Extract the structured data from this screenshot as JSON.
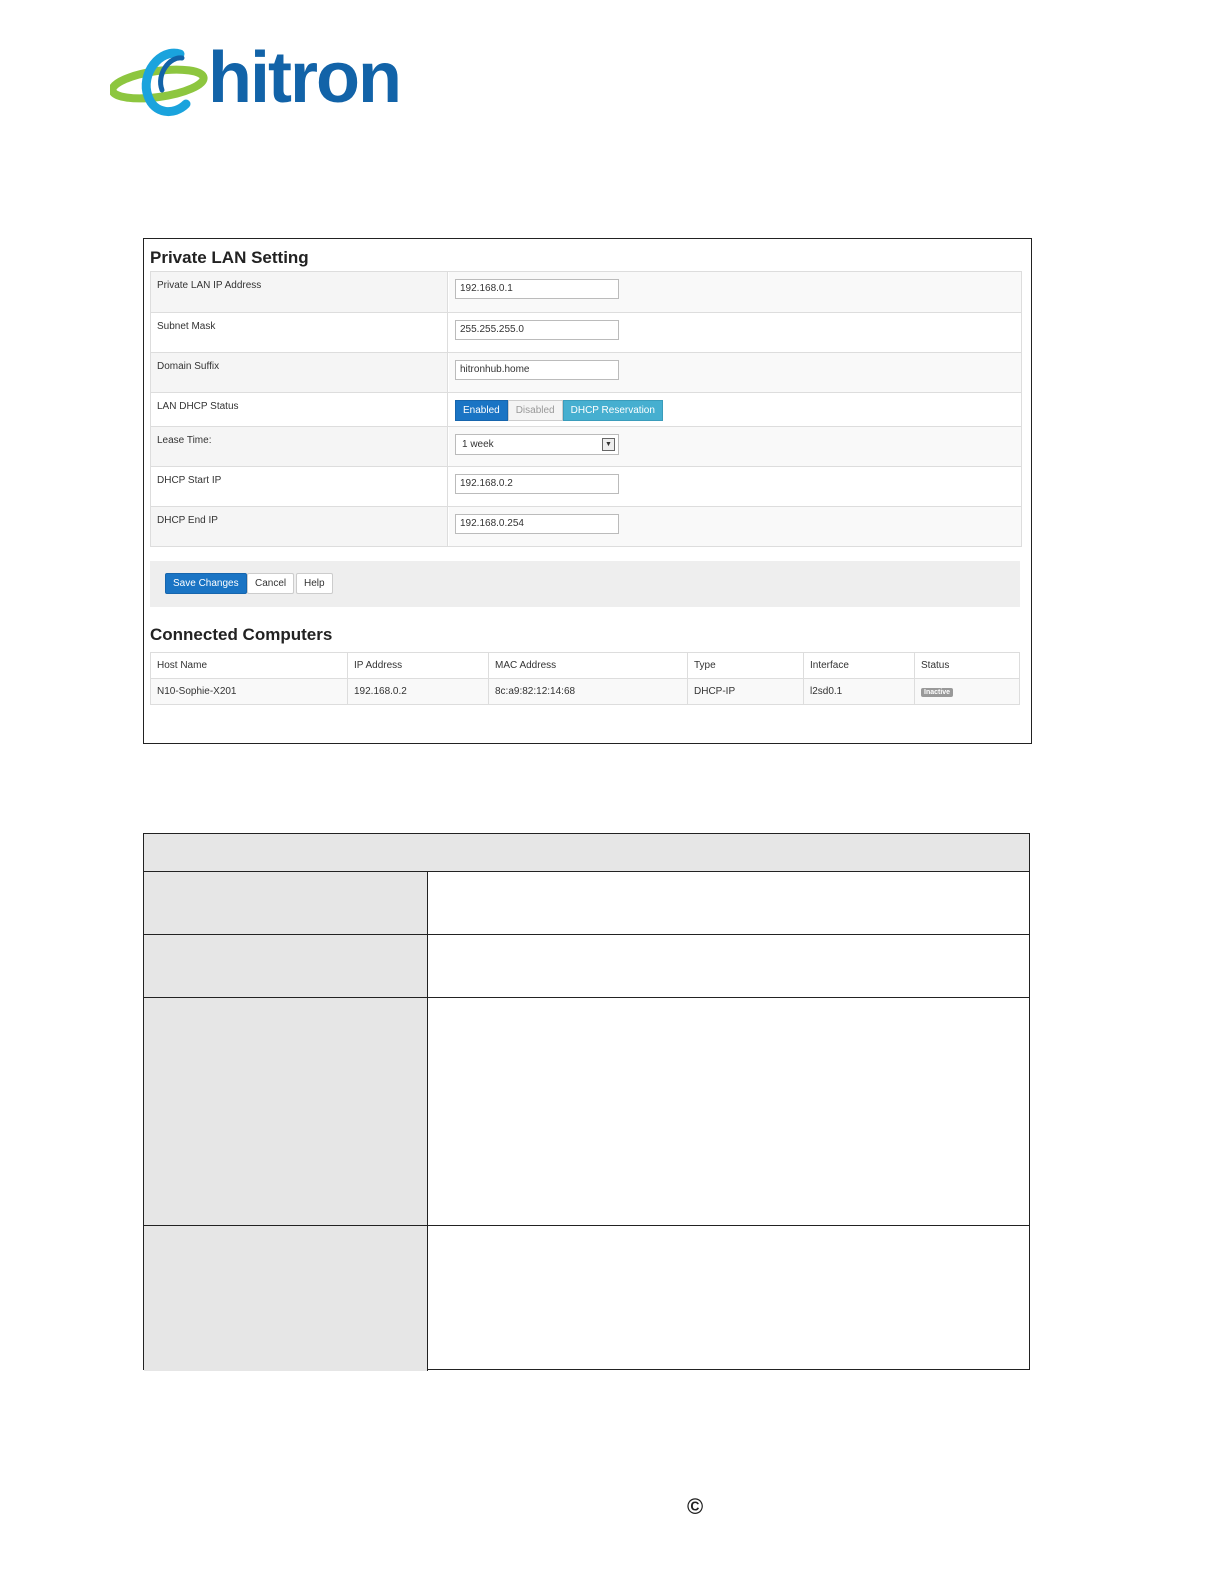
{
  "brand": {
    "logo_text": "hitron",
    "accent": "#1263a8",
    "swoosh": "#8dc63f"
  },
  "screenshot": {
    "title": "Private LAN Setting",
    "fields": [
      {
        "label": "Private LAN IP Address",
        "value": "192.168.0.1"
      },
      {
        "label": "Subnet Mask",
        "value": "255.255.255.0"
      },
      {
        "label": "Domain Suffix",
        "value": "hitronhub.home"
      },
      {
        "label": "LAN DHCP Status",
        "options": [
          "Enabled",
          "Disabled",
          "DHCP Reservation"
        ],
        "selected": "Enabled"
      },
      {
        "label": "Lease Time:",
        "value": "1 week"
      },
      {
        "label": "DHCP Start IP",
        "value": "192.168.0.2"
      },
      {
        "label": "DHCP End IP",
        "value": "192.168.0.254"
      }
    ],
    "buttons": {
      "save": "Save Changes",
      "cancel": "Cancel",
      "help": "Help"
    },
    "computers": {
      "title": "Connected Computers",
      "headers": [
        "Host Name",
        "IP Address",
        "MAC Address",
        "Type",
        "Interface",
        "Status"
      ],
      "rows": [
        {
          "host": "N10-Sophie-X201",
          "ip": "192.168.0.2",
          "mac": "8c:a9:82:12:14:68",
          "type": "DHCP-IP",
          "interface": "l2sd0.1",
          "status": "Inactive"
        }
      ]
    }
  },
  "footer": {
    "copyright": "©"
  }
}
